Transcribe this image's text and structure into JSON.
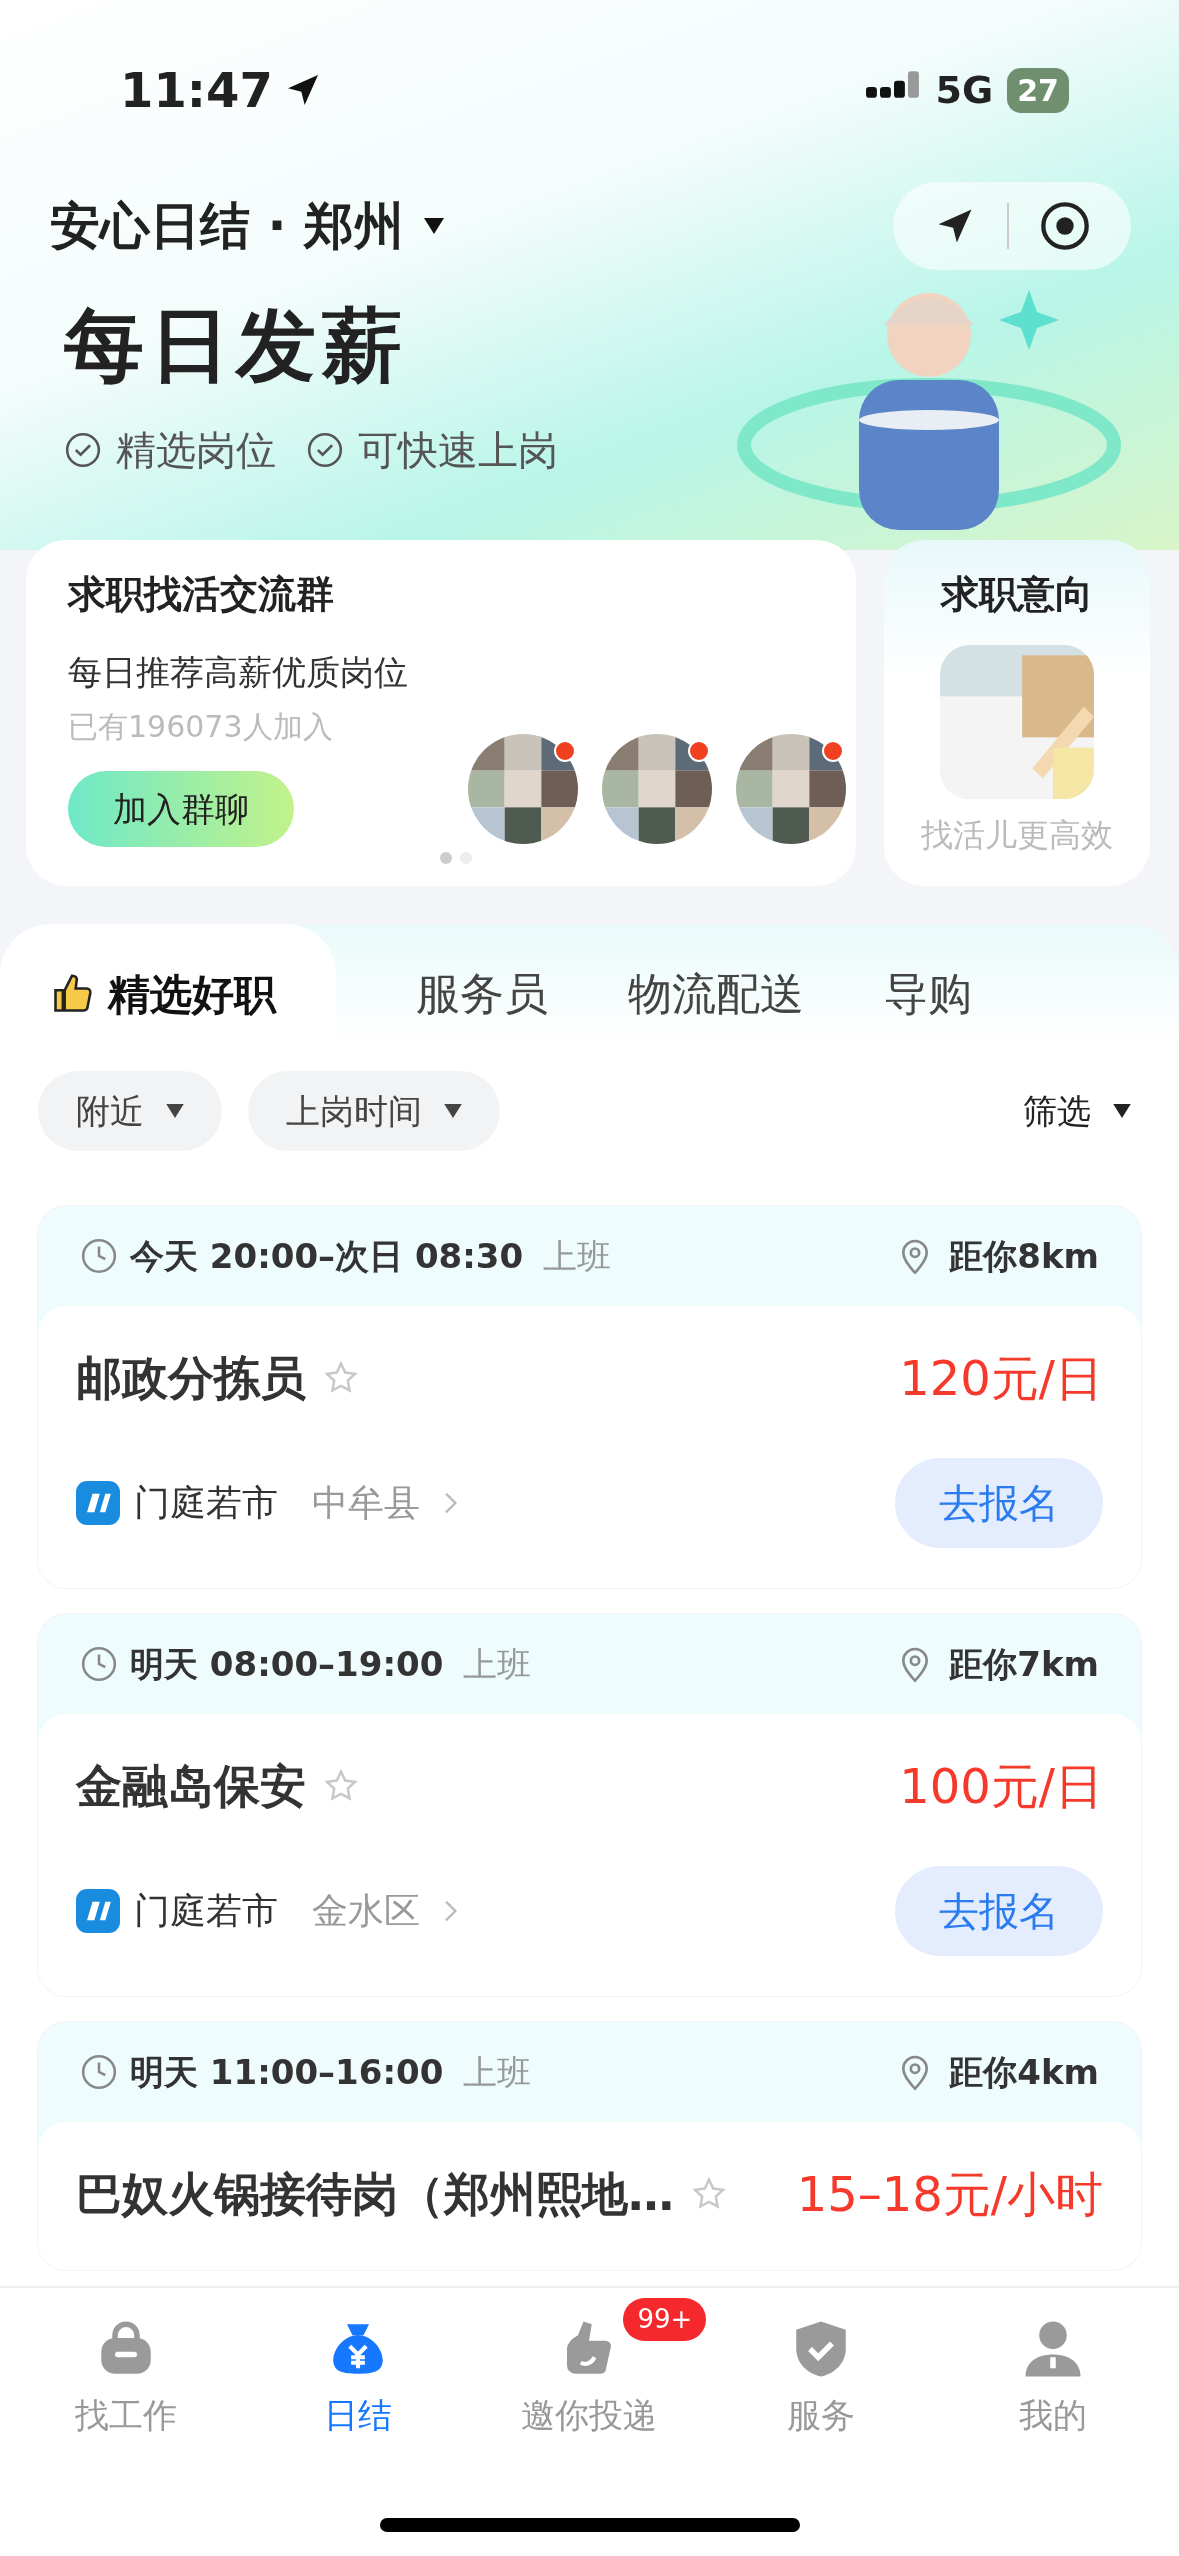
{
  "status_bar": {
    "time": "11:47",
    "network": "5G",
    "battery": "27"
  },
  "header": {
    "title": "安心日结 · 郑州"
  },
  "hero": {
    "title": "每日发薪",
    "features": [
      "精选岗位",
      "可快速上岗"
    ]
  },
  "group_card": {
    "title": "求职找活交流群",
    "subtitle": "每日推荐高薪优质岗位",
    "joined": "已有196073人加入",
    "button": "加入群聊",
    "carousel_dots": [
      {
        "selected": true
      },
      {
        "selected": false
      }
    ]
  },
  "intent_card": {
    "title": "求职意向",
    "caption": "找活儿更高效"
  },
  "tabs": [
    {
      "label": "精选好职",
      "selected": true
    },
    {
      "label": "服务员",
      "selected": false
    },
    {
      "label": "物流配送",
      "selected": false
    },
    {
      "label": "导购",
      "selected": false
    }
  ],
  "filters": [
    {
      "label": "附近"
    },
    {
      "label": "上岗时间"
    }
  ],
  "filter_button": "筛选",
  "jobs": [
    {
      "schedule": "今天 20:00–次日 08:30",
      "shift": "上班",
      "distance": "距你8km",
      "title": "邮政分拣员",
      "pay": "120元/日",
      "company": "门庭若市",
      "area": "中牟县",
      "action": "去报名"
    },
    {
      "schedule": "明天 08:00–19:00",
      "shift": "上班",
      "distance": "距你7km",
      "title": "金融岛保安",
      "pay": "100元/日",
      "company": "门庭若市",
      "area": "金水区",
      "action": "去报名"
    },
    {
      "schedule": "明天 11:00–16:00",
      "shift": "上班",
      "distance": "距你4km",
      "title": "巴奴火锅接待岗（郑州熙地…",
      "pay": "15–18元/小时"
    }
  ],
  "nav": [
    {
      "kind": "bag",
      "label": "找工作",
      "selected": false
    },
    {
      "kind": "money",
      "label": "日结",
      "selected": true
    },
    {
      "kind": "hand",
      "label": "邀你投递",
      "selected": false,
      "badge": "99+"
    },
    {
      "kind": "shield",
      "label": "服务",
      "selected": false
    },
    {
      "kind": "person",
      "label": "我的",
      "selected": false
    }
  ]
}
